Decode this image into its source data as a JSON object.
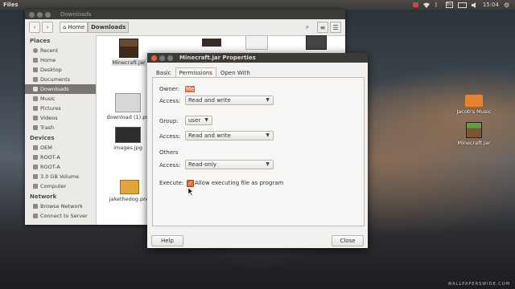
{
  "panel": {
    "app_title": "Files",
    "time": "15:04"
  },
  "nautilus": {
    "title": "Downloads",
    "breadcrumb": [
      "Home",
      "Downloads"
    ],
    "sidebar": {
      "places_head": "Places",
      "places": [
        "Recent",
        "Home",
        "Desktop",
        "Documents",
        "Downloads",
        "Music",
        "Pictures",
        "Videos",
        "Trash"
      ],
      "devices_head": "Devices",
      "devices": [
        "OEM",
        "ROOT-A",
        "ROOT-A",
        "3.0 GB Volume",
        "Computer"
      ],
      "network_head": "Network",
      "network": [
        "Browse Network",
        "Connect to Server"
      ]
    },
    "files": [
      "Minecraft.jar",
      "download (1).pn",
      "images.jpg",
      "jakethedog.png"
    ]
  },
  "dialog": {
    "title": "Minecraft.jar Properties",
    "tabs": [
      "Basic",
      "Permissions",
      "Open With"
    ],
    "owner_label": "Owner:",
    "owner_value": "Me",
    "access_label": "Access:",
    "owner_access": "Read and write",
    "group_label": "Group:",
    "group_value": "user",
    "group_access": "Read and write",
    "others_label": "Others",
    "others_access": "Read-only",
    "execute_label": "Execute:",
    "execute_checkbox": "Allow executing file as program",
    "help": "Help",
    "close": "Close"
  },
  "desktop": {
    "icons": [
      "Jacob's Music",
      "Minecraft.jar"
    ]
  },
  "watermark": "WALLPAPERSWIDE.COM",
  "colors": {
    "accent": "#e06d3b",
    "selection": "#7a7570",
    "titlebar": "#3c3b37"
  }
}
